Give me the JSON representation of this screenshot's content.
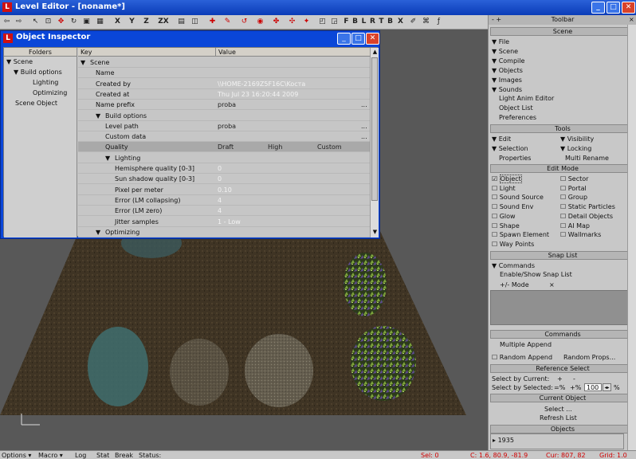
{
  "window": {
    "title": "Level Editor - [noname*]"
  },
  "window_buttons": {
    "minimize": "_",
    "maximize": "□",
    "close": "✕"
  },
  "toolbar": {
    "letters": [
      "X",
      "Y",
      "Z",
      "ZX"
    ],
    "filter_letters": [
      "F",
      "B",
      "L",
      "R",
      "T",
      "B",
      "X"
    ]
  },
  "inspector": {
    "title": "Object Inspector",
    "folders_header": "Folders",
    "key_header": "Key",
    "value_header": "Value",
    "folders": [
      {
        "label": "Scene",
        "expanded": true
      },
      {
        "label": "Build options",
        "expanded": true
      },
      {
        "label": "Lighting"
      },
      {
        "label": "Optimizing"
      },
      {
        "label": "Scene Object"
      }
    ],
    "rows": [
      {
        "key": "Scene",
        "value": "",
        "toggle": "▼"
      },
      {
        "key": "Name",
        "value": ""
      },
      {
        "key": "Created by",
        "value": "\\\\HOME-2169Z5F16C\\Kocтa"
      },
      {
        "key": "Created at",
        "value": "Thu Jul 23 16:20:44 2009"
      },
      {
        "key": "Name prefix",
        "value": "proba",
        "dots": "..."
      },
      {
        "key": "Build options",
        "value": "",
        "toggle": "▼"
      },
      {
        "key": "Level path",
        "value": "proba",
        "dots": "..."
      },
      {
        "key": "Custom data",
        "value": "",
        "dots": "..."
      },
      {
        "key": "Quality",
        "value": "Draft",
        "value2": "High",
        "value3": "Custom"
      },
      {
        "key": "Lighting",
        "value": "",
        "toggle": "▼"
      },
      {
        "key": "Hemisphere quality [0-3]",
        "value": "0"
      },
      {
        "key": "Sun shadow quality [0-3]",
        "value": "0"
      },
      {
        "key": "Pixel per meter",
        "value": "0.10"
      },
      {
        "key": "Error (LM collapsing)",
        "value": "4"
      },
      {
        "key": "Error (LM zero)",
        "value": "4"
      },
      {
        "key": "Jitter samples",
        "value": "1 - Low"
      },
      {
        "key": "Optimizing",
        "value": "",
        "toggle": "▼"
      }
    ]
  },
  "right_panel": {
    "title": "Toolbar",
    "scene_header": "Scene",
    "scene_items": [
      "File",
      "Scene",
      "Compile",
      "Objects",
      "Images",
      "Sounds",
      "Light Anim Editor",
      "Object List",
      "Preferences"
    ],
    "tools_header": "Tools",
    "tools_items": [
      [
        "Edit",
        "Visibility"
      ],
      [
        "Selection",
        "Locking"
      ],
      [
        "Properties",
        "Multi Rename"
      ]
    ],
    "editmode_header": "Edit Mode",
    "editmode_items": [
      [
        "Object",
        "Sector"
      ],
      [
        "Light",
        "Portal"
      ],
      [
        "Sound Source",
        "Group"
      ],
      [
        "Sound Env",
        "Static Particles"
      ],
      [
        "Glow",
        "Detail Objects"
      ],
      [
        "Shape",
        "AI Map"
      ],
      [
        "Spawn Element",
        "Wallmarks"
      ],
      [
        "Way Points",
        ""
      ]
    ],
    "snaplist_header": "Snap List",
    "snaplist_items": [
      "Commands",
      "Enable/Show Snap List"
    ],
    "snap_mode": "+/- Mode",
    "snap_x": "×",
    "commands_header": "Commands",
    "multiple_append": "Multiple Append",
    "random_append": "Random Append",
    "random_props": "Random Props...",
    "refselect_header": "Reference Select",
    "select_by_current": "Select by Current:",
    "select_by_selected": "Select by Selected:",
    "plus": "+",
    "minus": "-",
    "eq_pct": "=%",
    "plus_pct": "+%",
    "pct_value": "100",
    "pct_unit": "%",
    "current_object_header": "Current Object",
    "select_btn": "Select ...",
    "refresh_btn": "Refresh List",
    "objects_header": "Objects",
    "objects_count": "1935"
  },
  "statusbar": {
    "options": "Options",
    "macro": "Macro",
    "log": "Log",
    "stat": "Stat",
    "break": "Break",
    "status": "Status:",
    "sel": "Sel: 0",
    "coords": "C: 1.6, 80.9, -81.9",
    "cur": "Cur: 807, 82",
    "grid": "Grid: 1.0"
  }
}
